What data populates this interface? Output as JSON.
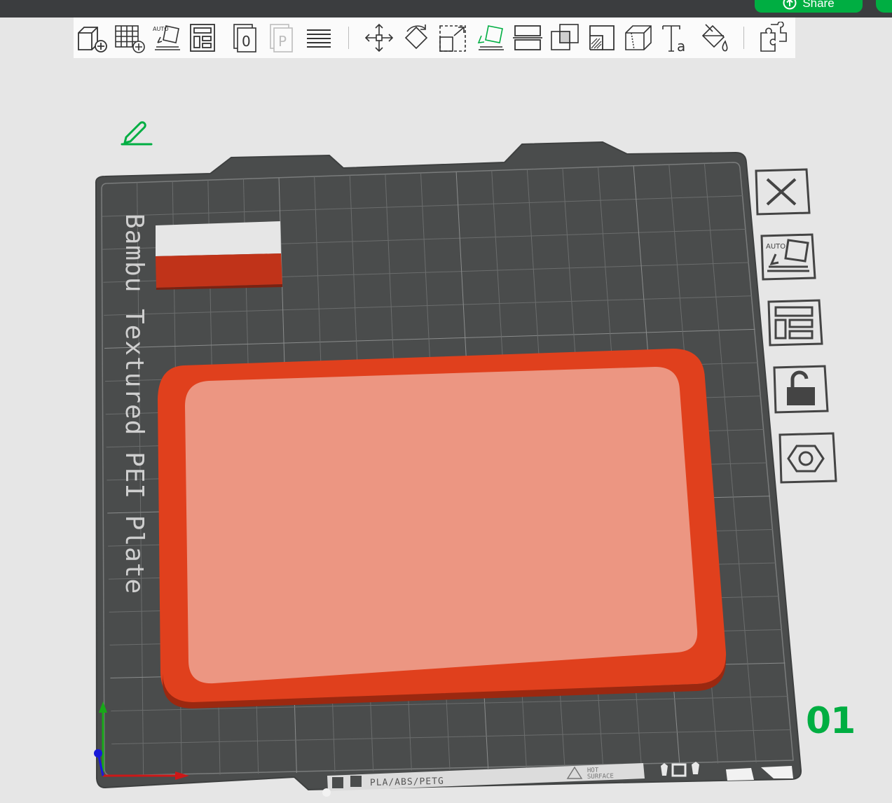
{
  "topbar": {
    "share_label": "Share",
    "accent_color": "#00ae42"
  },
  "toolbar": {
    "buttons": [
      {
        "name": "add-object-icon"
      },
      {
        "name": "add-plate-icon"
      },
      {
        "name": "auto-orient-icon",
        "badge": "AUTO"
      },
      {
        "name": "arrange-icon"
      },
      {
        "name": "plate-objects-icon",
        "badge": "0"
      },
      {
        "name": "plate-parts-icon",
        "badge": "P"
      },
      {
        "name": "layers-icon"
      },
      {
        "name": "move-icon"
      },
      {
        "name": "rotate-icon"
      },
      {
        "name": "scale-icon"
      },
      {
        "name": "lay-on-face-icon"
      },
      {
        "name": "cut-icon"
      },
      {
        "name": "boolean-icon"
      },
      {
        "name": "support-paint-icon"
      },
      {
        "name": "seam-paint-icon"
      },
      {
        "name": "text-icon",
        "badge": "Ta"
      },
      {
        "name": "color-paint-icon"
      },
      {
        "name": "assembly-icon"
      }
    ]
  },
  "plate": {
    "label": "Bambu Textured PEI Plate",
    "number": "01",
    "material_label": "PLA/ABS/PETG",
    "warning_label_1": "HOT",
    "warning_label_2": "SURFACE",
    "side_buttons": [
      {
        "name": "close-plate-icon"
      },
      {
        "name": "auto-orient-plate-icon",
        "badge": "AUTO"
      },
      {
        "name": "arrange-plate-icon"
      },
      {
        "name": "lock-plate-icon"
      },
      {
        "name": "plate-settings-icon"
      }
    ]
  },
  "colors": {
    "plate_bg": "#484a4a",
    "grid": "#6c6e6e",
    "tray_outer": "#e33f1d",
    "tray_inner": "#ec9580",
    "flag_white": "#e8e8e8",
    "flag_red": "#c03319"
  }
}
